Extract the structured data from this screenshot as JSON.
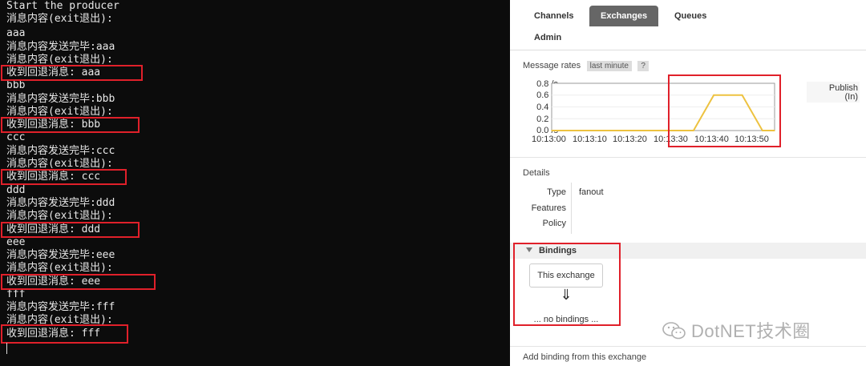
{
  "console": {
    "lines": [
      "Start the producer",
      "消息内容(exit退出):",
      "aaa",
      "消息内容发送完毕:aaa",
      "消息内容(exit退出):",
      "收到回退消息: aaa",
      "bbb",
      "消息内容发送完毕:bbb",
      "消息内容(exit退出):",
      "收到回退消息: bbb",
      "ccc",
      "消息内容发送完毕:ccc",
      "消息内容(exit退出):",
      "收到回退消息: ccc",
      "ddd",
      "消息内容发送完毕:ddd",
      "消息内容(exit退出):",
      "收到回退消息: ddd",
      "eee",
      "消息内容发送完毕:eee",
      "消息内容(exit退出):",
      "收到回退消息: eee",
      "fff",
      "消息内容发送完毕:fff",
      "消息内容(exit退出):",
      "收到回退消息: fff"
    ],
    "highlight_color": "#e0202a"
  },
  "tabs": {
    "channels": "Channels",
    "exchanges": "Exchanges",
    "queues": "Queues",
    "admin": "Admin"
  },
  "message_rates": {
    "label": "Message rates",
    "range": "last minute",
    "help": "?",
    "legend": [
      "Publish",
      "(In)"
    ]
  },
  "chart_data": {
    "type": "line",
    "yticks": [
      "0.8 /s",
      "0.6 /s",
      "0.4 /s",
      "0.2 /s",
      "0.0 /s"
    ],
    "xticks": [
      "10:13:00",
      "10:13:10",
      "10:13:20",
      "10:13:30",
      "10:13:40",
      "10:13:50"
    ],
    "ylim": [
      0,
      0.8
    ],
    "series": [
      {
        "name": "Publish (In)",
        "color": "#edc240",
        "x": [
          "10:13:00",
          "10:13:30",
          "10:13:35",
          "10:13:40",
          "10:13:43",
          "10:13:47",
          "10:13:52",
          "10:13:55"
        ],
        "y": [
          0,
          0,
          0,
          0.6,
          0.6,
          0.6,
          0,
          0
        ]
      }
    ]
  },
  "details": {
    "heading": "Details",
    "type_label": "Type",
    "type_value": "fanout",
    "features_label": "Features",
    "policy_label": "Policy"
  },
  "bindings": {
    "heading": "Bindings",
    "this_exchange": "This exchange",
    "arrow": "⇓",
    "none": "... no bindings ..."
  },
  "add_binding": "Add binding from this exchange",
  "watermark": "DotNET技术圈"
}
